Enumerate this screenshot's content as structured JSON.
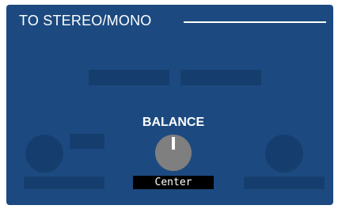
{
  "section": {
    "title": "TO STEREO/MONO"
  },
  "balance": {
    "label": "BALANCE",
    "value": "Center",
    "level": 0.5
  },
  "colors": {
    "panel_background": "#1c4a80",
    "inactive_control": "#153e6e",
    "knob": "#7f7f7f",
    "text": "#ffffff",
    "value_box": "#000000"
  }
}
